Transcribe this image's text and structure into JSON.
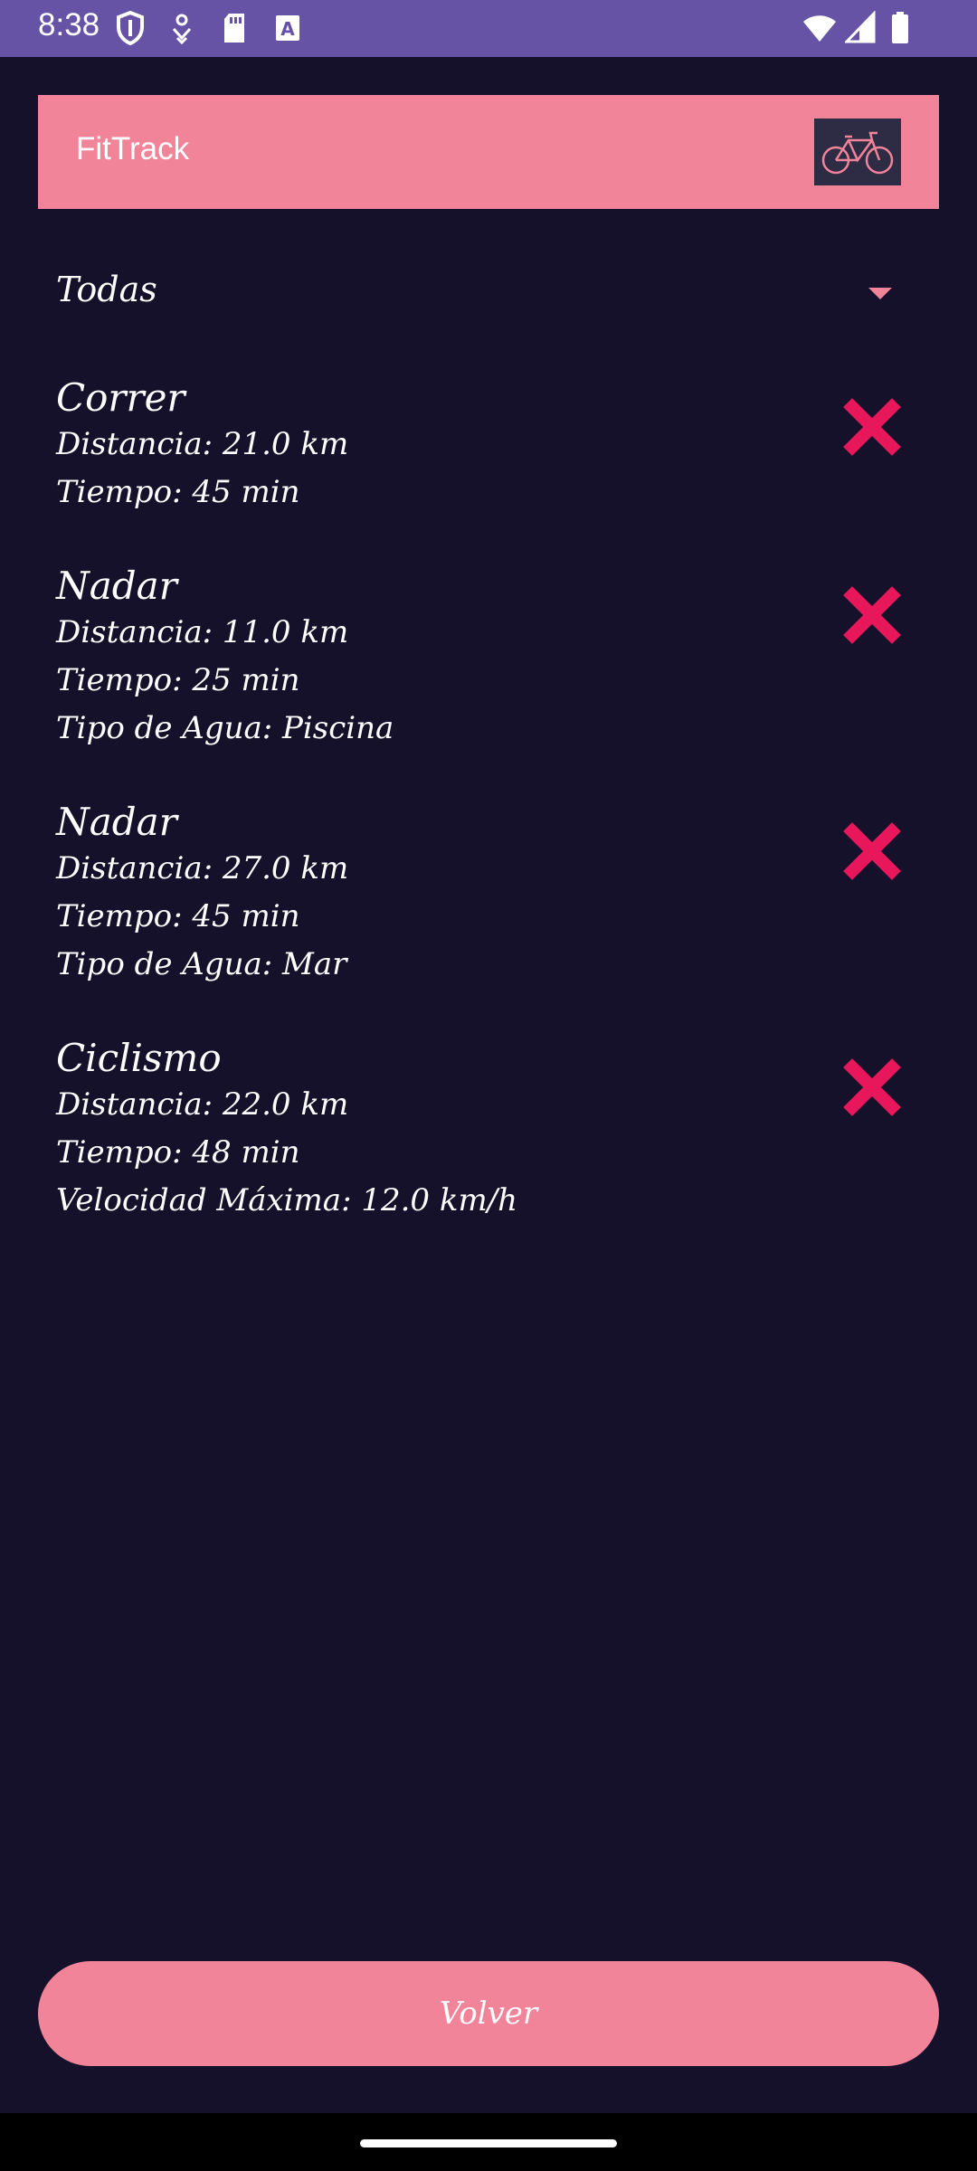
{
  "status_bar": {
    "time": "8:38",
    "icons": [
      "shield-icon",
      "fitness-icon",
      "sd-card-icon",
      "a-badge-icon",
      "wifi-icon",
      "signal-icon",
      "battery-icon"
    ]
  },
  "app_bar": {
    "title": "FitTrack",
    "logo_icon": "bicycle-icon"
  },
  "filter": {
    "selected": "Todas"
  },
  "activities": [
    {
      "title": "Correr",
      "lines": [
        "Distancia: 21.0 km",
        "Tiempo: 45 min"
      ]
    },
    {
      "title": "Nadar",
      "lines": [
        "Distancia: 11.0 km",
        "Tiempo: 25 min",
        "Tipo de Agua: Piscina"
      ]
    },
    {
      "title": "Nadar",
      "lines": [
        "Distancia: 27.0 km",
        "Tiempo: 45 min",
        "Tipo de Agua: Mar"
      ]
    },
    {
      "title": "Ciclismo",
      "lines": [
        "Distancia: 22.0 km",
        "Tiempo: 48 min",
        "Velocidad Máxima: 12.0 km/h"
      ]
    }
  ],
  "back_button": {
    "label": "Volver"
  },
  "colors": {
    "status_bar": "#6753a6",
    "accent": "#f28499",
    "background": "#15112b",
    "delete": "#e8165a"
  }
}
